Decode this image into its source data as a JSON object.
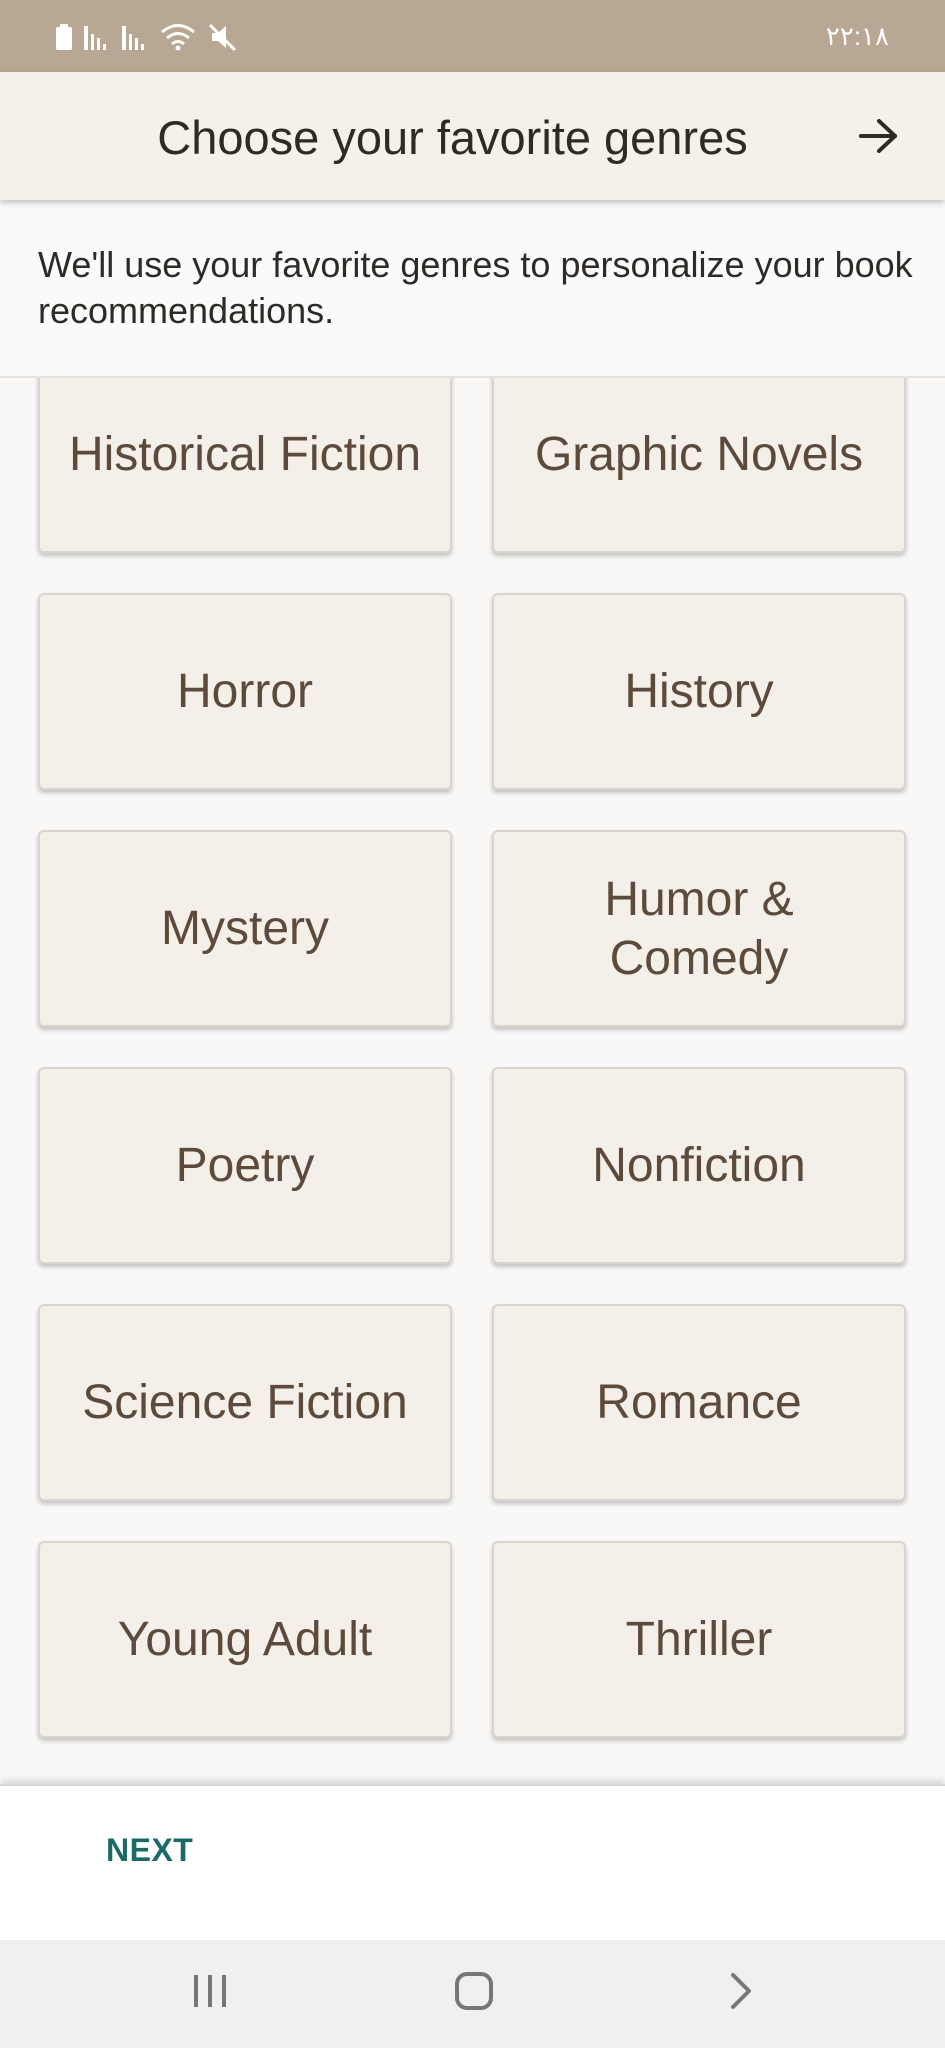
{
  "status_bar": {
    "time": "۲۲:۱۸",
    "icons": [
      "battery-icon",
      "signal-icon",
      "signal-icon",
      "wifi-icon",
      "mute-icon"
    ]
  },
  "header": {
    "title": "Choose your favorite genres",
    "forward_icon": "arrow-right-icon"
  },
  "description": "We'll use your favorite genres to personalize your book recommendations.",
  "genres": [
    "Historical Fiction",
    "Graphic Novels",
    "Horror",
    "History",
    "Mystery",
    "Humor & Comedy",
    "Poetry",
    "Nonfiction",
    "Science Fiction",
    "Romance",
    "Young Adult",
    "Thriller"
  ],
  "footer": {
    "next_label": "NEXT"
  },
  "nav_bar": {
    "icons": [
      "recent-apps-icon",
      "home-icon",
      "back-icon"
    ]
  },
  "colors": {
    "status_bar": "#b7a793",
    "header_bg": "#f5f1ea",
    "card_bg": "#f4efe8",
    "card_text": "#5c4a3c",
    "accent": "#1a6b66"
  }
}
